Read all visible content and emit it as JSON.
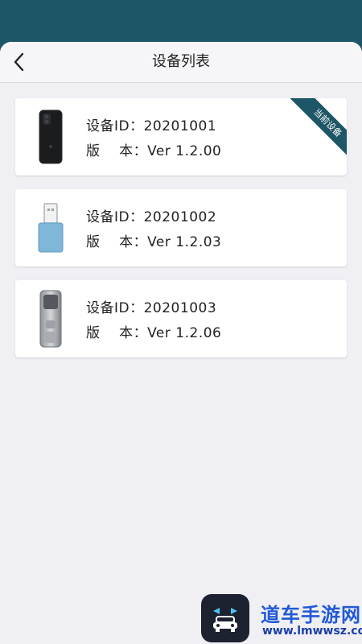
{
  "app": {
    "title": "设备列表"
  },
  "navbar": {
    "back_icon": "chevron-left-icon"
  },
  "devices": [
    {
      "id_label": "设备ID：",
      "id_value": "20201001",
      "version_label": "版    本：",
      "version_value": "Ver 1.2.00",
      "current": true,
      "badge_label": "当前设备",
      "image": "black-phone-case"
    },
    {
      "id_label": "设备ID：",
      "id_value": "20201002",
      "version_label": "版    本：",
      "version_value": "Ver 1.2.03",
      "current": false,
      "image": "blue-usb-dongle"
    },
    {
      "id_label": "设备ID：",
      "id_value": "20201003",
      "version_label": "版    本：",
      "version_value": "Ver 1.2.06",
      "current": false,
      "image": "silver-door-lock"
    }
  ],
  "watermark": {
    "title": "道车手游网",
    "url": "www.lmwwsz.com"
  },
  "colors": {
    "header_bg": "#1d5666",
    "page_bg": "#efeff4",
    "badge_bg": "#1d5666",
    "card_bg": "#ffffff"
  }
}
